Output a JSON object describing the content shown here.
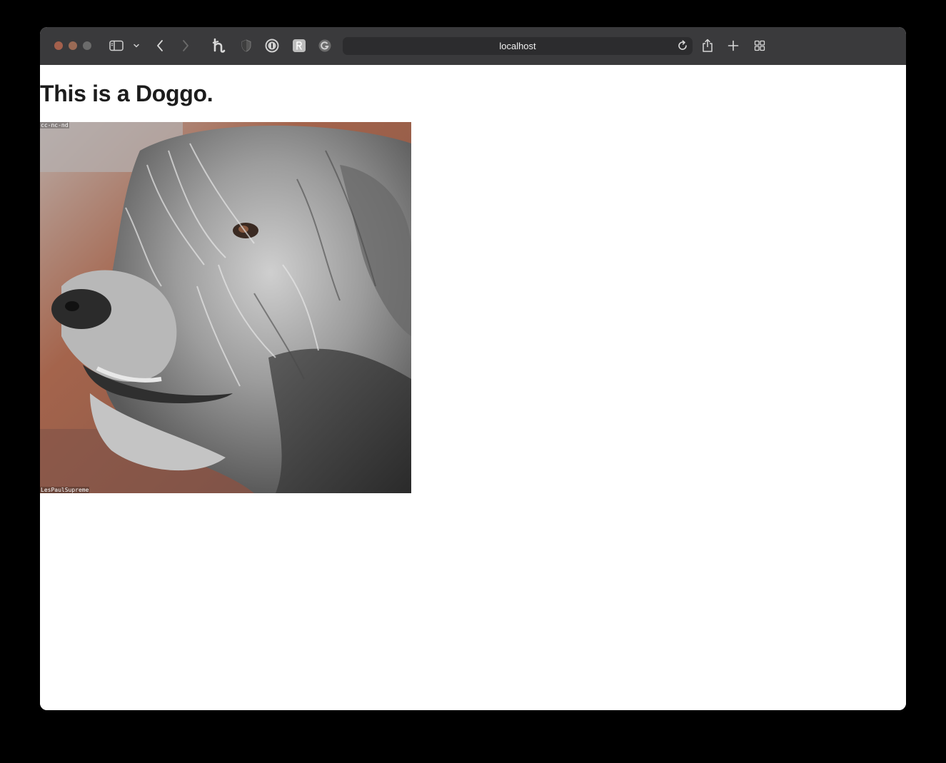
{
  "browser": {
    "url": "localhost",
    "traffic_lights": {
      "close_color": "#a4604c",
      "minimize_color": "#9a6a55",
      "maximize_color": "#6b6b6b"
    },
    "toolbar_icons": [
      "sidebar-icon",
      "chevron-down-icon",
      "back-icon",
      "forward-icon",
      "honey-extension-icon",
      "shield-extension-icon",
      "onepassword-extension-icon",
      "readwise-extension-icon",
      "grammarly-extension-icon",
      "reload-icon",
      "share-icon",
      "new-tab-icon",
      "tab-overview-icon"
    ]
  },
  "page": {
    "heading": "This is a Doggo.",
    "image": {
      "subject": "dog",
      "license_text": "cc-nc-nd",
      "credit_text": "LesPaulSupreme"
    }
  },
  "colors": {
    "toolbar_bg": "#3a3a3c",
    "page_bg": "#ffffff",
    "heading_color": "#1c1c1c"
  }
}
